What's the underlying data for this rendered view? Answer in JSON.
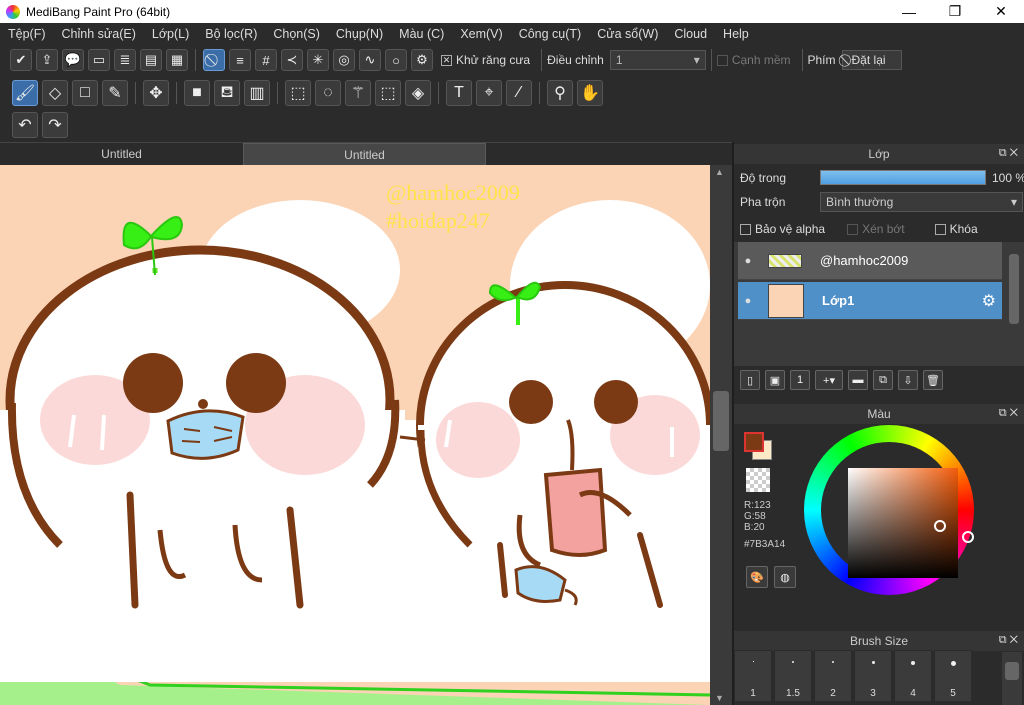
{
  "window": {
    "title": "MediBang Paint Pro (64bit)",
    "minimize": "—",
    "maximize": "❐",
    "close": "✕"
  },
  "menu": [
    "Tệp(F)",
    "Chỉnh sửa(E)",
    "Lớp(L)",
    "Bộ lọc(R)",
    "Chọn(S)",
    "Chụp(N)",
    "Màu (C)",
    "Xem(V)",
    "Công cụ(T)",
    "Cửa sổ(W)",
    "Cloud",
    "Help"
  ],
  "toolbar": {
    "antialias_label": "Khử răng cưa",
    "correction_label": "Điều chỉnh",
    "correction_value": "1",
    "soft_edge_label": "Cạnh mềm",
    "key_label": "Phím",
    "reset_label": "Đặt lại"
  },
  "tabs": [
    "Untitled",
    "Untitled"
  ],
  "canvas": {
    "watermark_1": "@hamhoc2009",
    "watermark_2": "#hoidap247"
  },
  "layers_panel": {
    "title": "Lớp",
    "opacity_label": "Độ trong",
    "opacity_value": "100 %",
    "blend_label": "Pha trộn",
    "blend_value": "Bình thường",
    "protect_alpha_label": "Bảo vệ alpha",
    "clipping_label": "Xén bớt",
    "lock_label": "Khóa",
    "layers": [
      {
        "name": "@hamhoc2009"
      },
      {
        "name": "Lớp1"
      }
    ]
  },
  "color_panel": {
    "title": "Màu",
    "r": "R:123",
    "g": "G:58",
    "b": "B:20",
    "hex": "#7B3A14",
    "fg_color": "#7B3A14",
    "bg_color": "#FCE9C8"
  },
  "brush_panel": {
    "title": "Brush Size",
    "sizes": [
      "1",
      "1.5",
      "2",
      "3",
      "4",
      "5"
    ]
  }
}
